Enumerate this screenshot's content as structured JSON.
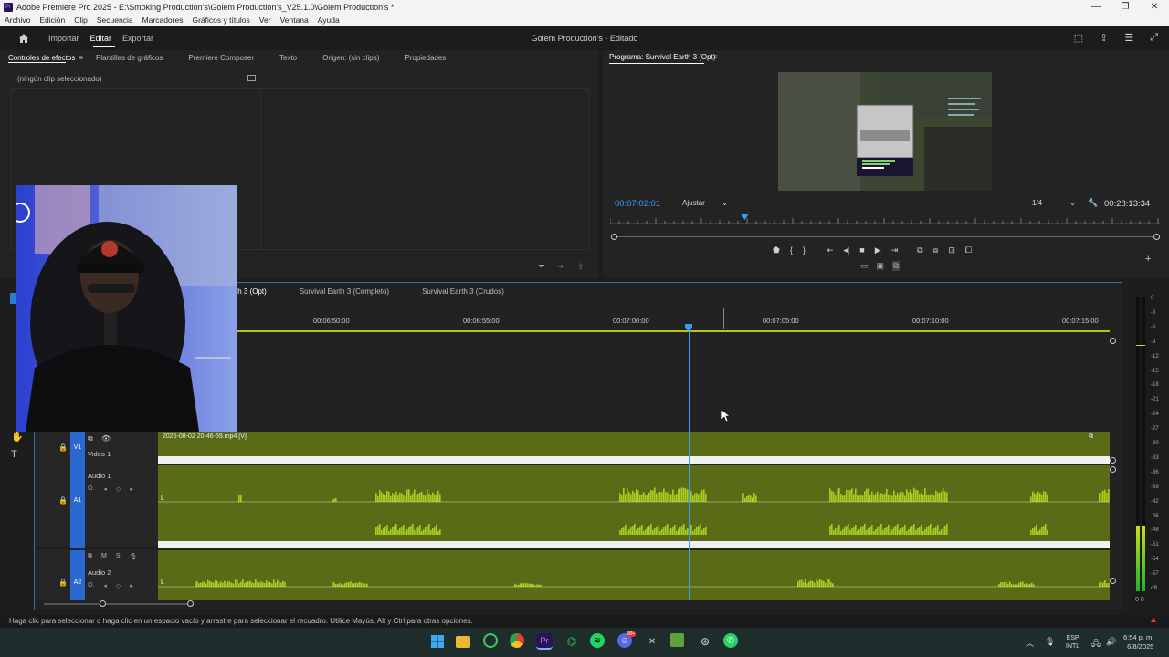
{
  "window": {
    "title": "Adobe Premiere Pro 2025 - E:\\Smoking Production's\\Golem Production's_V25.1.0\\Golem Production's *",
    "logo": "Pr",
    "controls": [
      "—",
      "❐",
      "✕"
    ]
  },
  "menu": [
    "Archivo",
    "Edición",
    "Clip",
    "Secuencia",
    "Marcadores",
    "Gráficos y títulos",
    "Ver",
    "Ventana",
    "Ayuda"
  ],
  "header": {
    "nav": [
      "Importar",
      "Editar",
      "Exportar"
    ],
    "active": "Editar",
    "project_title": "Golem Production's - Editado"
  },
  "source_panel": {
    "tabs": [
      "Controles de efectos",
      "Plantillas de gráficos",
      "Premiere Composer",
      "Texto",
      "Origen: (sin clips)",
      "Propiedades"
    ],
    "no_clip": "(ningún clip seleccionado)"
  },
  "program_panel": {
    "title": "Programa: Survival Earth 3 (Opt)",
    "timecode": "00:07:02:01",
    "fit": "Ajustar",
    "resolution": "1/4",
    "duration": "00:28:13:34",
    "playhead_fraction": 0.245
  },
  "timeline": {
    "tabs": [
      "th 3 (Opt)",
      "Survival Earth 3 (Completo)",
      "Survival Earth 3 (Crudos)"
    ],
    "ruler": [
      "00:06:50:00",
      "00:06:55:00",
      "00:07:00:00",
      "00:07:05:00",
      "00:07:10:00",
      "00:07:15:00"
    ],
    "tracks": {
      "v1": {
        "id": "V1",
        "name": "Video 1",
        "clip": "2025-08-02 20-46-59.mp4 [V]"
      },
      "a1": {
        "id": "A1",
        "name": "Audio 1",
        "ch": "L"
      },
      "a2": {
        "id": "A2",
        "name": "Audio 2",
        "ch": "L",
        "m": "M",
        "s": "S"
      }
    }
  },
  "meters": {
    "scale": [
      "0",
      "-3",
      "-6",
      "-9",
      "-12",
      "-15",
      "-18",
      "-21",
      "-24",
      "-27",
      "-30",
      "-33",
      "-36",
      "-39",
      "-42",
      "-45",
      "-48",
      "-51",
      "-54",
      "-57",
      "dB"
    ],
    "level_fraction": 0.7,
    "footer": "0   0"
  },
  "status": {
    "text": "Haga clic para seleccionar o haga clic en un espacio vacío y arrastre para seleccionar el recuadro. Utilice Mayús, Alt y Ctrl para otras opciones."
  },
  "taskbar": {
    "lang": "ESP",
    "layout": "INTL",
    "time": "6:54 p. m.",
    "date": "6/8/2025",
    "notify": "99+"
  },
  "colors": {
    "accent": "#3a9bff",
    "audio_clip": "#5a6b18",
    "wave": "#a6cf21"
  }
}
